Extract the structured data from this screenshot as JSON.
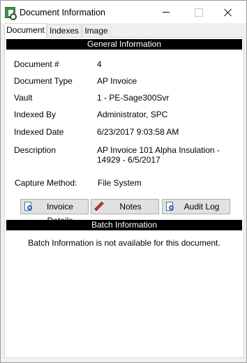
{
  "window": {
    "title": "Document Information",
    "icon": "document-capture-app-icon"
  },
  "tabs": [
    {
      "label": "Document",
      "active": true
    },
    {
      "label": "Indexes",
      "active": false
    },
    {
      "label": "Image",
      "active": false
    }
  ],
  "general": {
    "header": "General Information",
    "fields": {
      "document_number": {
        "label": "Document #",
        "value": "4"
      },
      "document_type": {
        "label": "Document Type",
        "value": "AP Invoice"
      },
      "vault": {
        "label": "Vault",
        "value": "1 - PE-Sage300Svr"
      },
      "indexed_by": {
        "label": "Indexed By",
        "value": "Administrator, SPC"
      },
      "indexed_date": {
        "label": "Indexed Date",
        "value": "6/23/2017 9:03:58 AM"
      },
      "description": {
        "label": "Description",
        "value_line1": "AP Invoice 101 Alpha Insulation -",
        "value_line2": "14929 - 6/5/2017"
      },
      "capture_method": {
        "label": "Capture Method:",
        "value": "File System"
      }
    }
  },
  "buttons": {
    "invoice_details": {
      "label": "Invoice Details",
      "icon": "document-magnifier-icon"
    },
    "notes": {
      "label": "Notes",
      "icon": "pencil-icon"
    },
    "audit_log": {
      "label": "Audit Log",
      "icon": "document-magnifier-icon"
    }
  },
  "batch": {
    "header": "Batch Information",
    "message": "Batch Information is not available for this document."
  }
}
